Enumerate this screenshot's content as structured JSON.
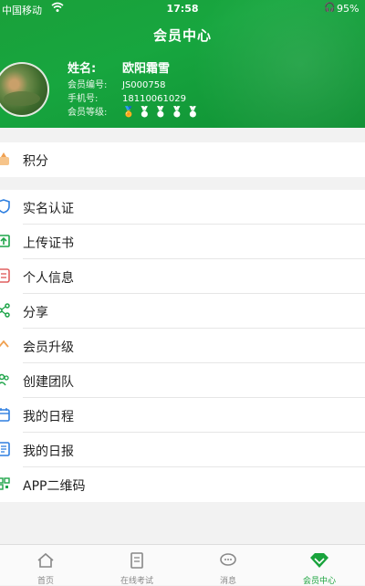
{
  "status_bar": {
    "carrier": "中国移动",
    "time": "17:58",
    "battery": "95%"
  },
  "header": {
    "title": "会员中心",
    "name_label": "姓名:",
    "name_value": "欧阳霜雪",
    "member_no_label": "会员编号:",
    "member_no_value": "JS000758",
    "phone_label": "手机号:",
    "phone_value": "18110061029",
    "level_label": "会员等级:",
    "level_active_count": 1,
    "level_total": 5
  },
  "points": {
    "label": "积分"
  },
  "menu": [
    {
      "label": "实名认证",
      "icon": "id-shield-icon"
    },
    {
      "label": "上传证书",
      "icon": "upload-icon"
    },
    {
      "label": "个人信息",
      "icon": "profile-icon"
    },
    {
      "label": "分享",
      "icon": "share-icon"
    },
    {
      "label": "会员升级",
      "icon": "upgrade-icon"
    },
    {
      "label": "创建团队",
      "icon": "team-icon"
    },
    {
      "label": "我的日程",
      "icon": "calendar-icon"
    },
    {
      "label": "我的日报",
      "icon": "report-icon"
    },
    {
      "label": "APP二维码",
      "icon": "qrcode-icon"
    }
  ],
  "tabs": [
    {
      "label": "首页",
      "icon": "home-icon"
    },
    {
      "label": "在线考试",
      "icon": "exam-icon"
    },
    {
      "label": "消息",
      "icon": "message-icon"
    },
    {
      "label": "会员中心",
      "icon": "member-center-icon",
      "active": true
    }
  ],
  "colors": {
    "brand_green": "#19a33c",
    "medal_gold": "#ffd54a",
    "icon_orange": "#f0a050",
    "icon_blue": "#2f7fe0",
    "icon_green": "#1fa54a",
    "icon_red": "#e06060"
  }
}
